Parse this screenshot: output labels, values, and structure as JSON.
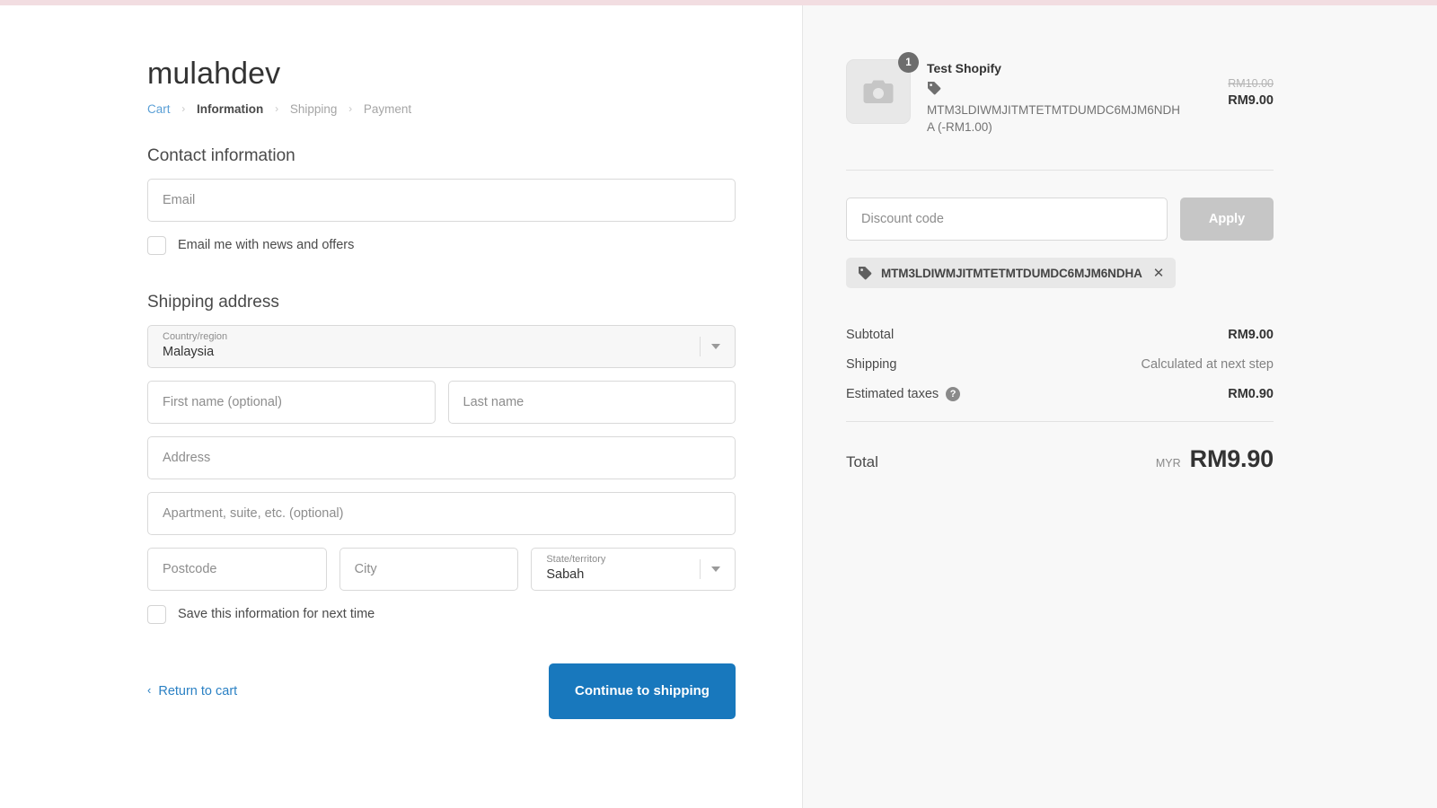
{
  "theme": {
    "top_strip_color": "#f2dde1",
    "accent_button_color": "#1878bd",
    "link_color": "#2b81c4",
    "summary_bg": "#f8f8f8"
  },
  "store": {
    "name": "mulahdev"
  },
  "breadcrumb": {
    "separator": "›",
    "items": [
      {
        "label": "Cart",
        "state": "link"
      },
      {
        "label": "Information",
        "state": "current"
      },
      {
        "label": "Shipping",
        "state": "upcoming"
      },
      {
        "label": "Payment",
        "state": "upcoming"
      }
    ]
  },
  "contact": {
    "title": "Contact information",
    "email_placeholder": "Email",
    "email_value": "",
    "newsletter_label": "Email me with news and offers",
    "newsletter_checked": false
  },
  "shipping_address": {
    "title": "Shipping address",
    "country": {
      "label": "Country/region",
      "value": "Malaysia"
    },
    "first_name_placeholder": "First name (optional)",
    "first_name_value": "",
    "last_name_placeholder": "Last name",
    "last_name_value": "",
    "address_placeholder": "Address",
    "address_value": "",
    "apartment_placeholder": "Apartment, suite, etc. (optional)",
    "apartment_value": "",
    "postcode_placeholder": "Postcode",
    "postcode_value": "",
    "city_placeholder": "City",
    "city_value": "",
    "state": {
      "label": "State/territory",
      "value": "Sabah"
    },
    "save_info_label": "Save this information for next time",
    "save_info_checked": false
  },
  "form_actions": {
    "return_to_cart": "Return to cart",
    "return_chevron": "‹",
    "continue_button": "Continue to shipping"
  },
  "order_summary": {
    "line_item": {
      "title": "Test Shopify",
      "quantity": "1",
      "discount_text": "MTM3LDIWMJITMTETMTDUMDC6MJM6NDHA (-RM1.00)",
      "original_price": "RM10.00",
      "price": "RM9.00"
    },
    "discount": {
      "placeholder": "Discount code",
      "value": "",
      "apply_label": "Apply",
      "applied_code": "MTM3LDIWMJITMTETMTDUMDC6MJM6NDHA",
      "remove_glyph": "✕"
    },
    "totals": [
      {
        "label": "Subtotal",
        "value": "RM9.00",
        "muted": false
      },
      {
        "label": "Shipping",
        "value": "Calculated at next step",
        "muted": true
      },
      {
        "label": "Estimated taxes",
        "value": "RM0.90",
        "muted": false,
        "help": "?"
      }
    ],
    "grand_total": {
      "label": "Total",
      "currency": "MYR",
      "amount": "RM9.90"
    }
  }
}
